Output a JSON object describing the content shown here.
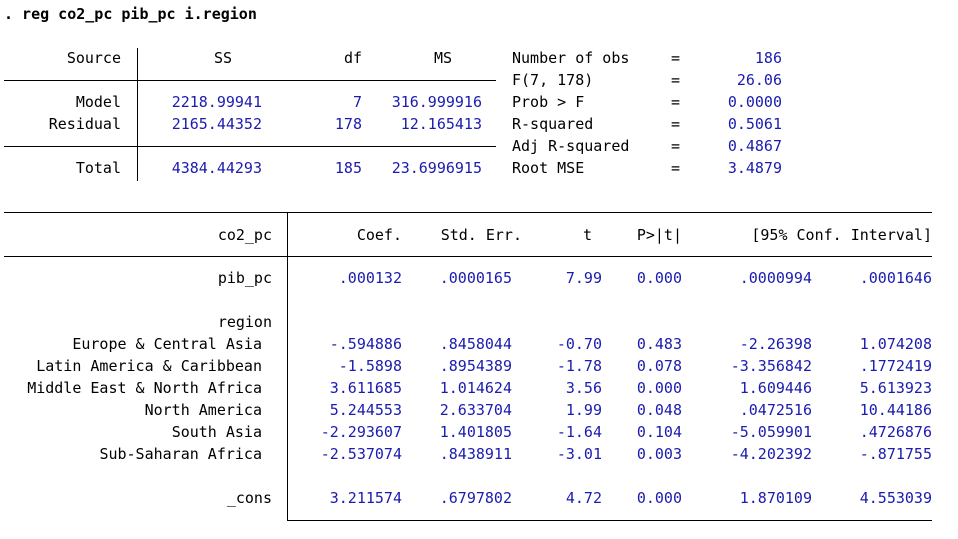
{
  "command": ". reg co2_pc pib_pc i.region",
  "anova": {
    "headers": {
      "source": "Source",
      "ss": "SS",
      "df": "df",
      "ms": "MS"
    },
    "rows": [
      {
        "source": "Model",
        "ss": "2218.99941",
        "df": "7",
        "ms": "316.999916"
      },
      {
        "source": "Residual",
        "ss": "2165.44352",
        "df": "178",
        "ms": "12.165413"
      },
      {
        "source": "Total",
        "ss": "4384.44293",
        "df": "185",
        "ms": "23.6996915"
      }
    ]
  },
  "stats": [
    {
      "label": "Number of obs",
      "eq": "=",
      "value": "186"
    },
    {
      "label": "F(7, 178)",
      "eq": "=",
      "value": "26.06"
    },
    {
      "label": "Prob > F",
      "eq": "=",
      "value": "0.0000"
    },
    {
      "label": "R-squared",
      "eq": "=",
      "value": "0.5061"
    },
    {
      "label": "Adj R-squared",
      "eq": "=",
      "value": "0.4867"
    },
    {
      "label": "Root MSE",
      "eq": "=",
      "value": "3.4879"
    }
  ],
  "coef_table": {
    "headers": {
      "var": "co2_pc",
      "coef": "Coef.",
      "se": "Std. Err.",
      "t": "t",
      "p": "P>|t|",
      "ci": "[95% Conf. Interval]"
    },
    "rows": [
      {
        "var": "pib_pc",
        "coef": ".000132",
        "se": ".0000165",
        "t": "7.99",
        "p": "0.000",
        "lo": ".0000994",
        "hi": ".0001646"
      },
      {
        "var": "region",
        "coef": "",
        "se": "",
        "t": "",
        "p": "",
        "lo": "",
        "hi": ""
      },
      {
        "var": "Europe & Central Asia",
        "coef": "-.594886",
        "se": ".8458044",
        "t": "-0.70",
        "p": "0.483",
        "lo": "-2.26398",
        "hi": "1.074208"
      },
      {
        "var": "Latin America & Caribbean",
        "coef": "-1.5898",
        "se": ".8954389",
        "t": "-1.78",
        "p": "0.078",
        "lo": "-3.356842",
        "hi": ".1772419"
      },
      {
        "var": "Middle East & North Africa",
        "coef": "3.611685",
        "se": "1.014624",
        "t": "3.56",
        "p": "0.000",
        "lo": "1.609446",
        "hi": "5.613923"
      },
      {
        "var": "North America",
        "coef": "5.244553",
        "se": "2.633704",
        "t": "1.99",
        "p": "0.048",
        "lo": ".0472516",
        "hi": "10.44186"
      },
      {
        "var": "South Asia",
        "coef": "-2.293607",
        "se": "1.401805",
        "t": "-1.64",
        "p": "0.104",
        "lo": "-5.059901",
        "hi": ".4726876"
      },
      {
        "var": "Sub-Saharan Africa",
        "coef": "-2.537074",
        "se": ".8438911",
        "t": "-3.01",
        "p": "0.003",
        "lo": "-4.202392",
        "hi": "-.871755"
      },
      {
        "var": "_cons",
        "coef": "3.211574",
        "se": ".6797802",
        "t": "4.72",
        "p": "0.000",
        "lo": "1.870109",
        "hi": "4.553039"
      }
    ]
  }
}
